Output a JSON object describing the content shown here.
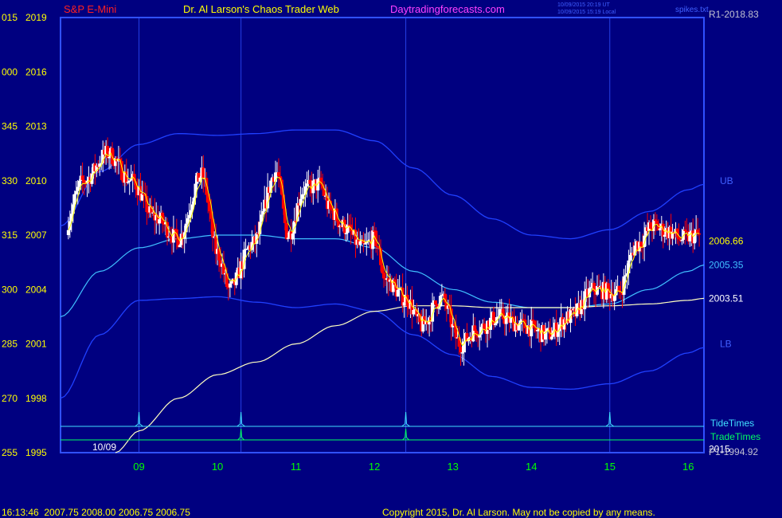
{
  "header": {
    "instrument": "S&P E-Mini",
    "site_title": "Dr. Al Larson's Chaos Trader Web",
    "site_url": "Daytradingforecasts.com",
    "timestamp_ut": "10/09/2015 20:19 UT",
    "timestamp_local": "10/09/2015 15:19 Local",
    "top_right_label": "spikes.txt"
  },
  "footer": {
    "quote_line": "16:13:46  2007.75 2008.00 2006.75 2006.75",
    "copyright": "Copyright 2015, Dr. Al Larson. May not be copied by any means."
  },
  "colors": {
    "background": "#000080",
    "frame": "#3050ff",
    "up_bar": "#ffffff",
    "down_bar": "#ff0000",
    "ema_fast": "#ffff00",
    "mid_band": "#40c0ff",
    "bands": "#2040ff",
    "slow_avg": "#ffffc0",
    "tide": "#40e0ff",
    "trade": "#00ff60",
    "axis_text": "#ffff00",
    "date_text": "#00ff00"
  },
  "chart_data": {
    "type": "candlestick",
    "title": "S&P E-Mini",
    "x_ticks": [
      "09",
      "10",
      "11",
      "12",
      "13",
      "14",
      "15",
      "16"
    ],
    "x_tick_hours": [
      8.0,
      9.0,
      10.0,
      11.0,
      12.0,
      13.0,
      14.0,
      15.0
    ],
    "x_range_hours": [
      7.0,
      15.2
    ],
    "start_date_label": "10/09",
    "y_range": [
      1995,
      2019
    ],
    "y_ticks_left": [
      "015",
      "000",
      "345",
      "330",
      "315",
      "300",
      "285",
      "270",
      "255"
    ],
    "y_ticks_right": [
      2019,
      2016,
      2013,
      2010,
      2007,
      2004,
      2001,
      1998,
      1995
    ],
    "right_labels": [
      {
        "text": "R1-2018.83",
        "value": 2018.83,
        "color": "#c0c0d0"
      },
      {
        "text": "UB",
        "value": 2010.0,
        "color": "#4060ff"
      },
      {
        "text": "2006.66",
        "value": 2006.66,
        "color": "#ffff00"
      },
      {
        "text": "2005.35",
        "value": 2005.35,
        "color": "#40c0ff"
      },
      {
        "text": "2003.51",
        "value": 2003.51,
        "color": "#ffffff"
      },
      {
        "text": "LB",
        "value": 2001.0,
        "color": "#4060ff"
      },
      {
        "text": "2015",
        "value": 1995.2,
        "color": "#ffffff"
      },
      {
        "text": "P1-1994.92",
        "value": 1994.92,
        "color": "#c0c0d0"
      }
    ],
    "legend": [
      {
        "text": "TideTimes",
        "color": "#40e0ff"
      },
      {
        "text": "TradeTimes",
        "color": "#00ff60"
      }
    ],
    "tide_times_hours": [
      8.0,
      9.3,
      11.4,
      14.0
    ],
    "trade_times_hours": [
      9.3,
      11.4
    ],
    "anchor_points": [
      {
        "h": 7.0,
        "v": 2007.0
      },
      {
        "h": 7.3,
        "v": 2010.0
      },
      {
        "h": 7.6,
        "v": 2011.5
      },
      {
        "h": 7.9,
        "v": 2010.0
      },
      {
        "h": 8.2,
        "v": 2008.0
      },
      {
        "h": 8.5,
        "v": 2006.8
      },
      {
        "h": 8.8,
        "v": 2010.3
      },
      {
        "h": 9.0,
        "v": 2006.0
      },
      {
        "h": 9.15,
        "v": 2004.0
      },
      {
        "h": 9.45,
        "v": 2006.5
      },
      {
        "h": 9.75,
        "v": 2010.5
      },
      {
        "h": 9.9,
        "v": 2007.0
      },
      {
        "h": 10.1,
        "v": 2009.5
      },
      {
        "h": 10.3,
        "v": 2009.8
      },
      {
        "h": 10.45,
        "v": 2008.3
      },
      {
        "h": 10.6,
        "v": 2007.5
      },
      {
        "h": 10.85,
        "v": 2006.3
      },
      {
        "h": 11.0,
        "v": 2006.8
      },
      {
        "h": 11.15,
        "v": 2004.5
      },
      {
        "h": 11.4,
        "v": 2003.5
      },
      {
        "h": 11.6,
        "v": 2002.0
      },
      {
        "h": 11.85,
        "v": 2003.5
      },
      {
        "h": 12.1,
        "v": 2001.0
      },
      {
        "h": 12.3,
        "v": 2001.8
      },
      {
        "h": 12.6,
        "v": 2002.5
      },
      {
        "h": 12.9,
        "v": 2002.0
      },
      {
        "h": 13.2,
        "v": 2001.5
      },
      {
        "h": 13.5,
        "v": 2002.5
      },
      {
        "h": 13.8,
        "v": 2004.0
      },
      {
        "h": 14.1,
        "v": 2003.8
      },
      {
        "h": 14.35,
        "v": 2006.5
      },
      {
        "h": 14.55,
        "v": 2007.5
      },
      {
        "h": 14.75,
        "v": 2007.2
      },
      {
        "h": 14.9,
        "v": 2006.8
      },
      {
        "h": 15.1,
        "v": 2007.0
      }
    ],
    "mid_band_points": [
      {
        "h": 7.0,
        "v": 2002.5
      },
      {
        "h": 7.5,
        "v": 2005.0
      },
      {
        "h": 8.0,
        "v": 2006.3
      },
      {
        "h": 8.5,
        "v": 2006.8
      },
      {
        "h": 9.0,
        "v": 2007.0
      },
      {
        "h": 9.5,
        "v": 2007.0
      },
      {
        "h": 10.0,
        "v": 2006.8
      },
      {
        "h": 10.5,
        "v": 2006.8
      },
      {
        "h": 11.0,
        "v": 2006.3
      },
      {
        "h": 11.5,
        "v": 2005.0
      },
      {
        "h": 12.0,
        "v": 2004.0
      },
      {
        "h": 12.5,
        "v": 2003.3
      },
      {
        "h": 13.0,
        "v": 2003.0
      },
      {
        "h": 13.5,
        "v": 2003.0
      },
      {
        "h": 14.0,
        "v": 2003.2
      },
      {
        "h": 14.5,
        "v": 2004.0
      },
      {
        "h": 15.0,
        "v": 2005.0
      },
      {
        "h": 15.2,
        "v": 2005.35
      }
    ],
    "upper_band_points": [
      {
        "h": 7.0,
        "v": 2007.5
      },
      {
        "h": 7.5,
        "v": 2010.5
      },
      {
        "h": 8.0,
        "v": 2012.0
      },
      {
        "h": 8.5,
        "v": 2012.6
      },
      {
        "h": 9.0,
        "v": 2012.5
      },
      {
        "h": 9.5,
        "v": 2012.6
      },
      {
        "h": 10.0,
        "v": 2012.8
      },
      {
        "h": 10.5,
        "v": 2012.8
      },
      {
        "h": 11.0,
        "v": 2012.2
      },
      {
        "h": 11.5,
        "v": 2010.7
      },
      {
        "h": 12.0,
        "v": 2009.2
      },
      {
        "h": 12.5,
        "v": 2007.9
      },
      {
        "h": 13.0,
        "v": 2007.0
      },
      {
        "h": 13.5,
        "v": 2006.8
      },
      {
        "h": 14.0,
        "v": 2007.3
      },
      {
        "h": 14.5,
        "v": 2008.3
      },
      {
        "h": 15.0,
        "v": 2009.5
      },
      {
        "h": 15.2,
        "v": 2009.8
      }
    ],
    "lower_band_points": [
      {
        "h": 7.0,
        "v": 1998.0
      },
      {
        "h": 7.5,
        "v": 2001.5
      },
      {
        "h": 8.0,
        "v": 2003.4
      },
      {
        "h": 8.5,
        "v": 2003.5
      },
      {
        "h": 9.0,
        "v": 2003.6
      },
      {
        "h": 9.5,
        "v": 2003.3
      },
      {
        "h": 10.0,
        "v": 2003.0
      },
      {
        "h": 10.5,
        "v": 2003.2
      },
      {
        "h": 11.0,
        "v": 2002.8
      },
      {
        "h": 11.5,
        "v": 2001.5
      },
      {
        "h": 12.0,
        "v": 2000.4
      },
      {
        "h": 12.5,
        "v": 1999.2
      },
      {
        "h": 13.0,
        "v": 1998.6
      },
      {
        "h": 13.5,
        "v": 1998.5
      },
      {
        "h": 14.0,
        "v": 1998.8
      },
      {
        "h": 14.5,
        "v": 1999.5
      },
      {
        "h": 15.0,
        "v": 2000.5
      },
      {
        "h": 15.2,
        "v": 2000.8
      }
    ],
    "slow_avg_points": [
      {
        "h": 7.7,
        "v": 1995.0
      },
      {
        "h": 8.0,
        "v": 1996.2
      },
      {
        "h": 8.5,
        "v": 1998.0
      },
      {
        "h": 9.0,
        "v": 1999.3
      },
      {
        "h": 9.5,
        "v": 2000.0
      },
      {
        "h": 10.0,
        "v": 2001.0
      },
      {
        "h": 10.5,
        "v": 2002.0
      },
      {
        "h": 11.0,
        "v": 2002.8
      },
      {
        "h": 11.5,
        "v": 2003.1
      },
      {
        "h": 12.0,
        "v": 2003.1
      },
      {
        "h": 12.5,
        "v": 2003.0
      },
      {
        "h": 13.0,
        "v": 2003.0
      },
      {
        "h": 13.5,
        "v": 2003.0
      },
      {
        "h": 14.0,
        "v": 2003.1
      },
      {
        "h": 14.5,
        "v": 2003.2
      },
      {
        "h": 15.0,
        "v": 2003.4
      },
      {
        "h": 15.2,
        "v": 2003.51
      }
    ]
  }
}
